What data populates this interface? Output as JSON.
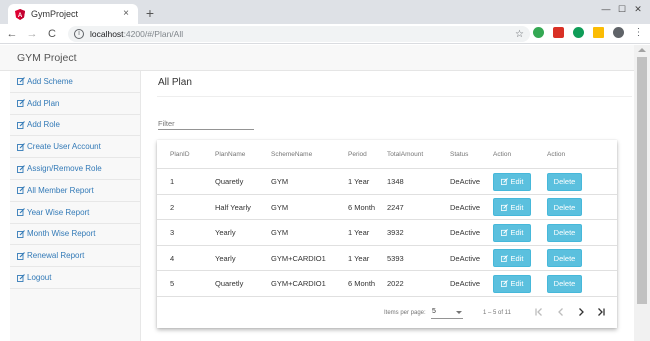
{
  "browser": {
    "tab_title": "GymProject",
    "tab_close": "×",
    "new_tab": "+",
    "url_host": "localhost",
    "url_path": ":4200/#/Plan/All",
    "window_controls": [
      "—",
      "☐",
      "✕"
    ],
    "nav": {
      "back": "←",
      "forward": "→",
      "reload": "C",
      "home": "⌂"
    },
    "bookmark_icon": "star-icon",
    "extension_colors": [
      "#34a853",
      "#d93025",
      "#0f9d58",
      "#fbbc04",
      "#5f6368"
    ]
  },
  "app": {
    "brand": "GYM Project",
    "accent": "#337ab7",
    "button_color": "#5bc0de"
  },
  "sidebar": {
    "items": [
      {
        "label": "Add Scheme",
        "icon": "edit-icon"
      },
      {
        "label": "Add Plan",
        "icon": "edit-icon"
      },
      {
        "label": "Add Role",
        "icon": "edit-icon"
      },
      {
        "label": "Create User Account",
        "icon": "edit-icon"
      },
      {
        "label": "Assign/Remove Role",
        "icon": "edit-icon"
      },
      {
        "label": "All Member Report",
        "icon": "edit-icon"
      },
      {
        "label": "Year Wise Report",
        "icon": "edit-icon"
      },
      {
        "label": "Month Wise Report",
        "icon": "edit-icon"
      },
      {
        "label": "Renewal Report",
        "icon": "edit-icon"
      },
      {
        "label": "Logout",
        "icon": "edit-icon"
      }
    ]
  },
  "main": {
    "title": "All Plan",
    "filter_placeholder": "Filter",
    "filter_value": ""
  },
  "table": {
    "columns": [
      "PlanID",
      "PlanName",
      "SchemeName",
      "Period",
      "TotalAmount",
      "Status",
      "Action",
      "Action"
    ],
    "edit_label": "Edit",
    "delete_label": "Delete",
    "rows": [
      {
        "id": "1",
        "plan": "Quaretly",
        "scheme": "GYM",
        "period": "1 Year",
        "amount": "1348",
        "status": "DeActive"
      },
      {
        "id": "2",
        "plan": "Half Yearly",
        "scheme": "GYM",
        "period": "6 Month",
        "amount": "2247",
        "status": "DeActive"
      },
      {
        "id": "3",
        "plan": "Yearly",
        "scheme": "GYM",
        "period": "1 Year",
        "amount": "3932",
        "status": "DeActive"
      },
      {
        "id": "4",
        "plan": "Yearly",
        "scheme": "GYM+CARDIO1",
        "period": "1 Year",
        "amount": "5393",
        "status": "DeActive"
      },
      {
        "id": "5",
        "plan": "Quaretly",
        "scheme": "GYM+CARDIO1",
        "period": "6 Month",
        "amount": "2022",
        "status": "DeActive"
      }
    ]
  },
  "paginator": {
    "items_per_page_label": "Items per page:",
    "page_size": "5",
    "range": "1 – 5 of 11"
  }
}
